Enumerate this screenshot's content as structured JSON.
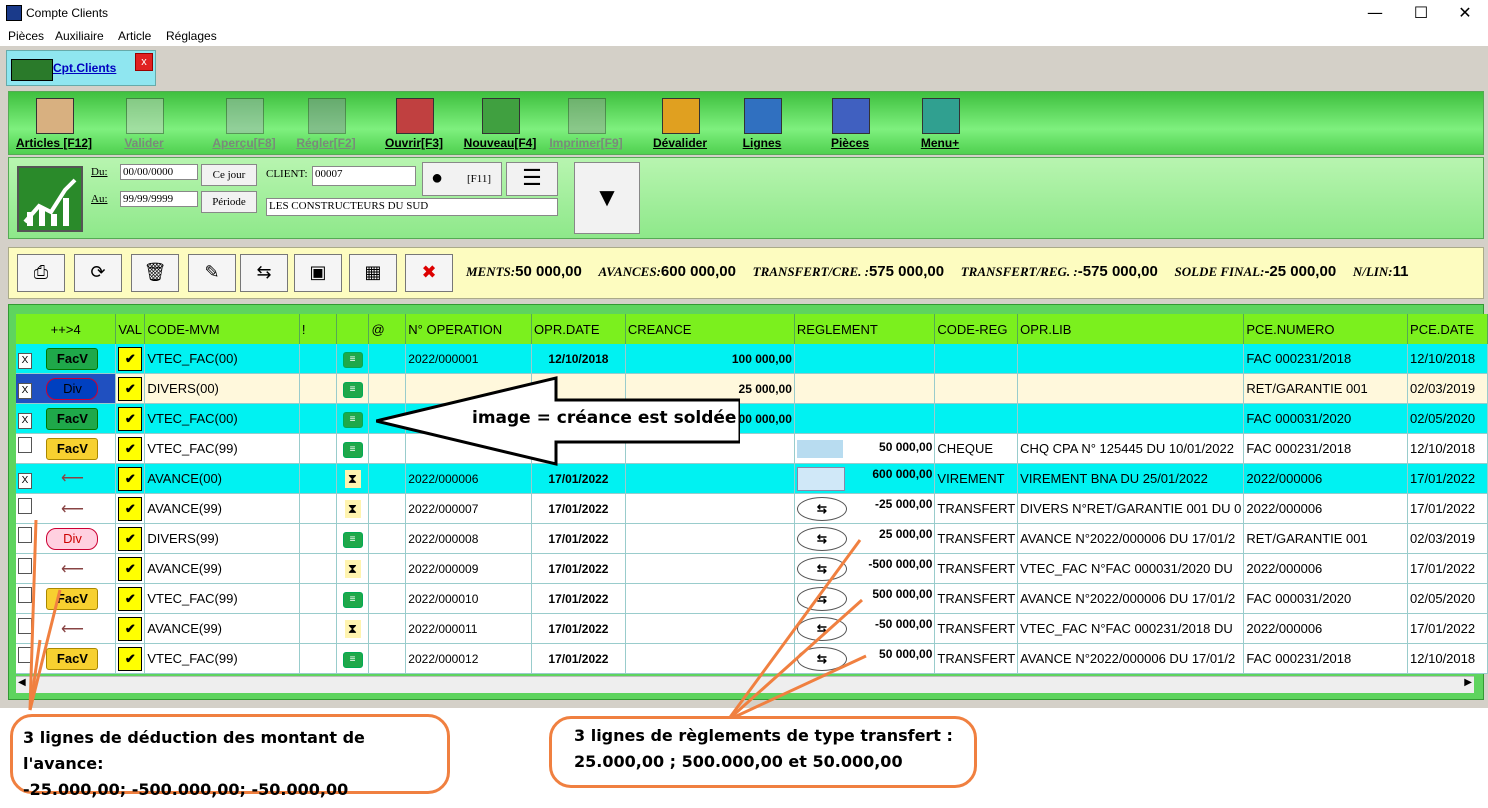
{
  "window": {
    "title": "Compte Clients",
    "minimize": "—",
    "maximize": "☐",
    "close": "✕"
  },
  "menu": [
    "Pièces",
    "Auxiliaire",
    "Article",
    "Réglages"
  ],
  "tab": {
    "label": "Cpt.Clients",
    "close": "x"
  },
  "toolbar": [
    {
      "label": "Articles [F12]",
      "icon": "articles-icon",
      "enabled": true
    },
    {
      "label": "Valider",
      "icon": "validate-icon",
      "enabled": false
    },
    {
      "label": "Aperçu[F8]",
      "icon": "preview-icon",
      "enabled": false
    },
    {
      "label": "Régler[F2]",
      "icon": "settle-icon",
      "enabled": false
    },
    {
      "label": "Ouvrir[F3]",
      "icon": "open-icon",
      "enabled": true
    },
    {
      "label": "Nouveau[F4]",
      "icon": "new-icon",
      "enabled": true
    },
    {
      "label": "Imprimer[F9]",
      "icon": "print-icon",
      "enabled": false
    },
    {
      "label": "Dévalider",
      "icon": "invalidate-icon",
      "enabled": true
    },
    {
      "label": "Lignes",
      "icon": "lines-icon",
      "enabled": true
    },
    {
      "label": "Pièces",
      "icon": "documents-icon",
      "enabled": true
    },
    {
      "label": "Menu+",
      "icon": "menu-icon",
      "enabled": true
    }
  ],
  "filter": {
    "du_label": "Du:",
    "du_value": "00/00/0000",
    "au_label": "Au:",
    "au_value": "99/99/9999",
    "ce_jour": "Ce jour",
    "periode": "Période",
    "client_label": "CLIENT:",
    "client_value": "00007",
    "client_name": "LES CONSTRUCTEURS DU SUD",
    "f11": "[F11]"
  },
  "totals": {
    "t1_label": "MENTS:",
    "t1_value": "50 000,00",
    "t2_label": "AVANCES:",
    "t2_value": "600 000,00",
    "t3_label": "TRANSFERT/CRE. :",
    "t3_value": "575 000,00",
    "t4_label": "TRANSFERT/REG. :",
    "t4_value": "-575 000,00",
    "t5_label": "SOLDE FINAL:",
    "t5_value": "-25 000,00",
    "t6_label": "N/LIN:",
    "t6_value": "11"
  },
  "grid": {
    "columns": [
      "++>4",
      "VAL",
      "CODE-MVM",
      "!",
      "",
      "@",
      "N° OPERATION",
      "OPR.DATE",
      "CREANCE",
      "REGLEMENT",
      "CODE-REG",
      "OPR.LIB",
      "PCE.NUMERO",
      "PCE.DATE"
    ],
    "rows": [
      {
        "style": "cyan",
        "checked": "X",
        "badge": "FacV",
        "badge_type": "facv",
        "code": "VTEC_FAC(00)",
        "status": "eq",
        "op": "2022/000001",
        "date": "12/10/2018",
        "creance": "100 000,00",
        "reg_icon": "",
        "reglement": "",
        "code_reg": "",
        "lib": "",
        "pce_num": "FAC 000231/2018",
        "pce_date": "12/10/2018"
      },
      {
        "style": "sel",
        "checked": "X",
        "badge": "Div",
        "badge_type": "div b",
        "code": "DIVERS(00)",
        "status": "eq",
        "op": "",
        "date": "",
        "creance": "25 000,00",
        "reg_icon": "",
        "reglement": "",
        "code_reg": "",
        "lib": "",
        "pce_num": "RET/GARANTIE 001",
        "pce_date": "02/03/2019"
      },
      {
        "style": "cyan",
        "checked": "X",
        "badge": "FacV",
        "badge_type": "facv",
        "code": "VTEC_FAC(00)",
        "status": "eq",
        "op": "",
        "date": "",
        "creance": "00 000,00",
        "reg_icon": "",
        "reglement": "",
        "code_reg": "",
        "lib": "",
        "pce_num": "FAC 000031/2020",
        "pce_date": "02/05/2020"
      },
      {
        "style": "white",
        "checked": "",
        "badge": "FacV",
        "badge_type": "facv y",
        "code": "VTEC_FAC(99)",
        "status": "eq",
        "op": "",
        "date": "",
        "creance": "",
        "reg_icon": "chq",
        "reglement": "50 000,00",
        "code_reg": "CHEQUE",
        "lib": "CHQ CPA N° 125445 DU 10/01/2022",
        "pce_num": "FAC 000231/2018",
        "pce_date": "12/10/2018"
      },
      {
        "style": "cyan",
        "checked": "X",
        "badge": "",
        "badge_type": "arrow",
        "code": "AVANCE(00)",
        "status": "hg",
        "op": "2022/000006",
        "date": "17/01/2022",
        "creance": "",
        "reg_icon": "vir",
        "reglement": "600 000,00",
        "code_reg": "VIREMENT",
        "lib": "VIREMENT BNA DU 25/01/2022",
        "pce_num": "2022/000006",
        "pce_date": "17/01/2022"
      },
      {
        "style": "white",
        "checked": "",
        "badge": "",
        "badge_type": "arrow",
        "code": "AVANCE(99)",
        "status": "hg",
        "op": "2022/000007",
        "date": "17/01/2022",
        "creance": "",
        "reg_icon": "tr",
        "reglement": "-25 000,00",
        "code_reg": "TRANSFERT",
        "lib": "DIVERS N°RET/GARANTIE 001 DU 0",
        "pce_num": "2022/000006",
        "pce_date": "17/01/2022"
      },
      {
        "style": "white",
        "checked": "",
        "badge": "Div",
        "badge_type": "div",
        "code": "DIVERS(99)",
        "status": "eq",
        "op": "2022/000008",
        "date": "17/01/2022",
        "creance": "",
        "reg_icon": "tr",
        "reglement": "25 000,00",
        "code_reg": "TRANSFERT",
        "lib": "AVANCE N°2022/000006 DU 17/01/2",
        "pce_num": "RET/GARANTIE 001",
        "pce_date": "02/03/2019"
      },
      {
        "style": "white",
        "checked": "",
        "badge": "",
        "badge_type": "arrow",
        "code": "AVANCE(99)",
        "status": "hg",
        "op": "2022/000009",
        "date": "17/01/2022",
        "creance": "",
        "reg_icon": "tr",
        "reglement": "-500 000,00",
        "code_reg": "TRANSFERT",
        "lib": "VTEC_FAC N°FAC 000031/2020 DU",
        "pce_num": "2022/000006",
        "pce_date": "17/01/2022"
      },
      {
        "style": "white",
        "checked": "",
        "badge": "FacV",
        "badge_type": "facv y",
        "code": "VTEC_FAC(99)",
        "status": "eq",
        "op": "2022/000010",
        "date": "17/01/2022",
        "creance": "",
        "reg_icon": "tr",
        "reglement": "500 000,00",
        "code_reg": "TRANSFERT",
        "lib": "AVANCE N°2022/000006 DU 17/01/2",
        "pce_num": "FAC 000031/2020",
        "pce_date": "02/05/2020"
      },
      {
        "style": "white",
        "checked": "",
        "badge": "",
        "badge_type": "arrow",
        "code": "AVANCE(99)",
        "status": "hg",
        "op": "2022/000011",
        "date": "17/01/2022",
        "creance": "",
        "reg_icon": "tr",
        "reglement": "-50 000,00",
        "code_reg": "TRANSFERT",
        "lib": "VTEC_FAC N°FAC 000231/2018 DU",
        "pce_num": "2022/000006",
        "pce_date": "17/01/2022"
      },
      {
        "style": "white",
        "checked": "",
        "badge": "FacV",
        "badge_type": "facv y",
        "code": "VTEC_FAC(99)",
        "status": "eq",
        "op": "2022/000012",
        "date": "17/01/2022",
        "creance": "",
        "reg_icon": "tr",
        "reglement": "50 000,00",
        "code_reg": "TRANSFERT",
        "lib": "AVANCE N°2022/000006 DU 17/01/2",
        "pce_num": "FAC 000231/2018",
        "pce_date": "12/10/2018"
      }
    ]
  },
  "annotations": {
    "arrow_text": "image = créance est soldée",
    "callout1_line1": "3 lignes de déduction des montant de l'avance:",
    "callout1_line2": "-25.000,00;  -500.000,00; -50.000,00",
    "callout2_line1": "3 lignes de règlements de type transfert :",
    "callout2_line2": "25.000,00 ; 500.000,00 et 50.000,00"
  },
  "colors": {
    "cyan_row": "#00f2f2",
    "header_green": "#7bf01e",
    "toolbar_green": "#3fc03f",
    "callout_border": "#f08040"
  }
}
